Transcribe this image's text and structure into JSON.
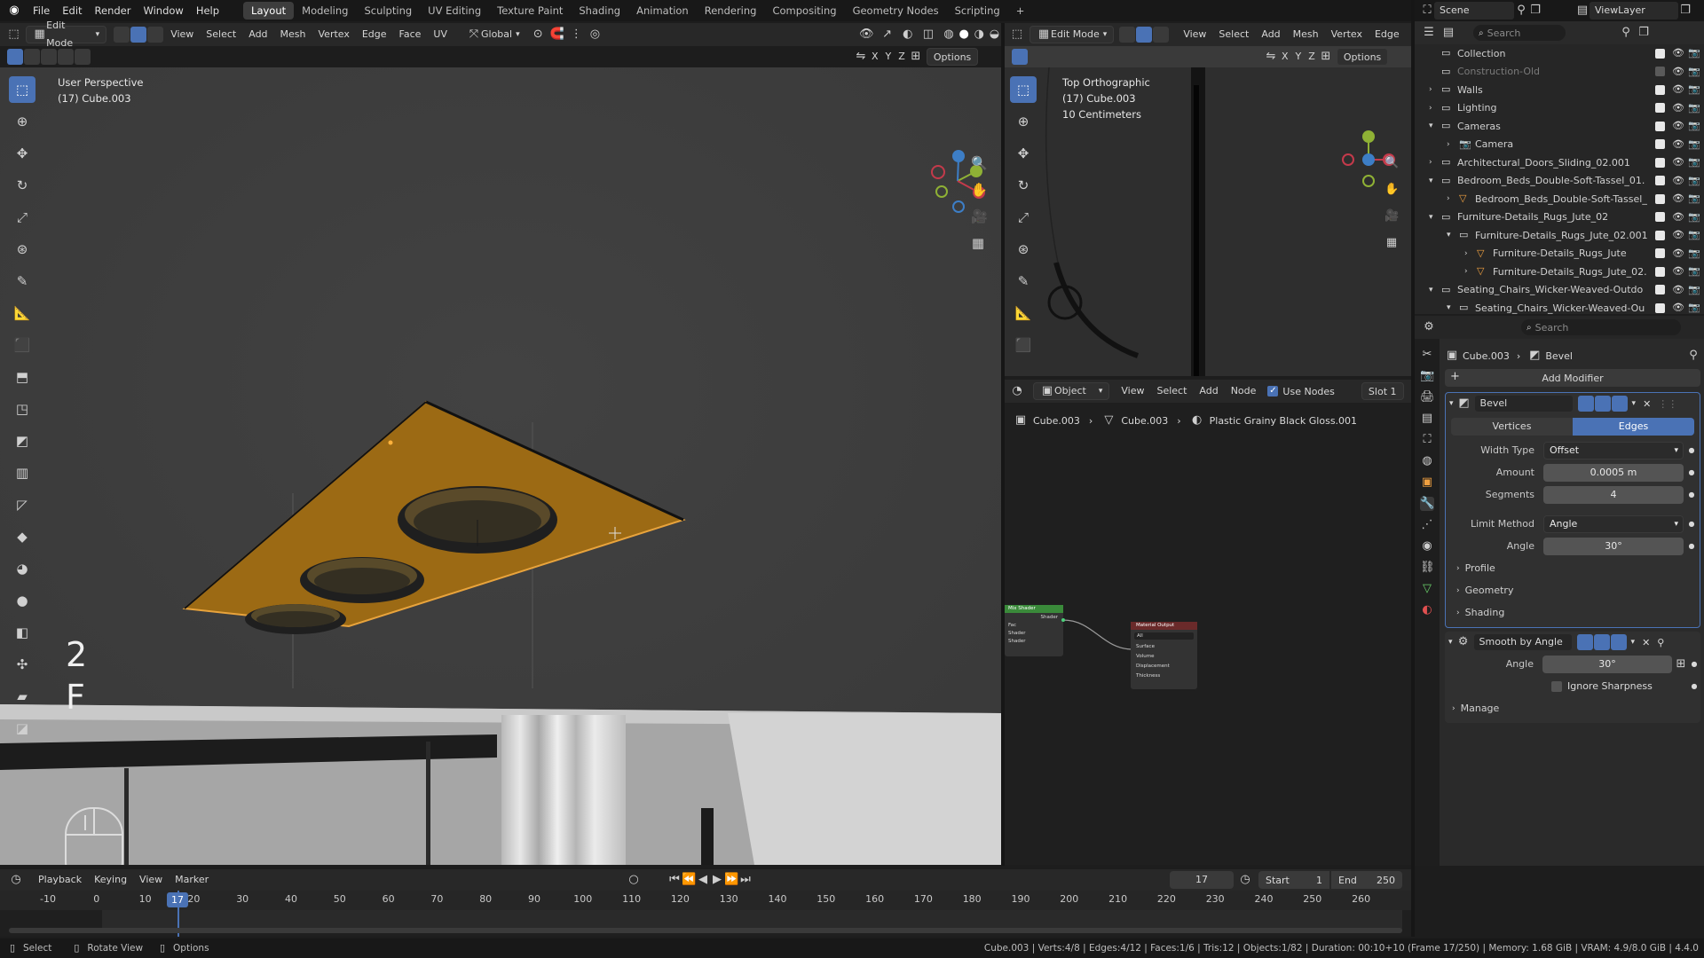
{
  "topbar": {
    "menus": [
      "File",
      "Edit",
      "Render",
      "Window",
      "Help"
    ],
    "workspaces": [
      "Layout",
      "Modeling",
      "Sculpting",
      "UV Editing",
      "Texture Paint",
      "Shading",
      "Animation",
      "Rendering",
      "Compositing",
      "Geometry Nodes",
      "Scripting"
    ],
    "active_workspace": "Layout",
    "scene": "Scene",
    "view_layer": "ViewLayer"
  },
  "viewport_left": {
    "mode": "Edit Mode",
    "menus": [
      "View",
      "Select",
      "Add",
      "Mesh",
      "Vertex",
      "Edge",
      "Face",
      "UV"
    ],
    "transform_orientation": "Global",
    "options": "Options",
    "axes": [
      "X",
      "Y",
      "Z"
    ],
    "overlay_title": "User Perspective",
    "overlay_object": "(17) Cube.003",
    "key_hint_1": "2",
    "key_hint_2": "F"
  },
  "viewport_right": {
    "mode": "Edit Mode",
    "menus": [
      "View",
      "Select",
      "Add",
      "Mesh",
      "Vertex",
      "Edge"
    ],
    "options": "Options",
    "axes": [
      "X",
      "Y",
      "Z"
    ],
    "overlay_title": "Top Orthographic",
    "overlay_object": "(17) Cube.003",
    "overlay_scale": "10 Centimeters"
  },
  "node_editor": {
    "type": "Object",
    "menus": [
      "View",
      "Select",
      "Add",
      "Node"
    ],
    "use_nodes_label": "Use Nodes",
    "slot": "Slot 1",
    "breadcrumb": [
      "Cube.003",
      "Cube.003",
      "Plastic Grainy Black Gloss.001"
    ],
    "node_mix": "Mix Shader",
    "node_mix_out": "Shader",
    "node_mix_inputs": [
      "Fac",
      "Shader",
      "Shader"
    ],
    "node_output": "Material Output",
    "node_output_target": "All",
    "node_output_inputs": [
      "Surface",
      "Volume",
      "Displacement",
      "Thickness"
    ]
  },
  "outliner": {
    "search_placeholder": "Search",
    "items": [
      {
        "label": "Collection",
        "depth": 0,
        "expand": "",
        "icon": "collection"
      },
      {
        "label": "Construction-Old",
        "depth": 0,
        "expand": "",
        "icon": "collection",
        "dim": true
      },
      {
        "label": "Walls",
        "depth": 0,
        "expand": ">",
        "icon": "collection"
      },
      {
        "label": "Lighting",
        "depth": 0,
        "expand": ">",
        "icon": "collection"
      },
      {
        "label": "Cameras",
        "depth": 0,
        "expand": "v",
        "icon": "collection"
      },
      {
        "label": "Camera",
        "depth": 1,
        "expand": ">",
        "icon": "camera"
      },
      {
        "label": "Architectural_Doors_Sliding_02.001",
        "depth": 0,
        "expand": ">",
        "icon": "collection"
      },
      {
        "label": "Bedroom_Beds_Double-Soft-Tassel_01.",
        "depth": 0,
        "expand": "v",
        "icon": "collection"
      },
      {
        "label": "Bedroom_Beds_Double-Soft-Tassel_",
        "depth": 1,
        "expand": ">",
        "icon": "mesh"
      },
      {
        "label": "Furniture-Details_Rugs_Jute_02",
        "depth": 0,
        "expand": "v",
        "icon": "collection"
      },
      {
        "label": "Furniture-Details_Rugs_Jute_02.001",
        "depth": 1,
        "expand": "v",
        "icon": "collection"
      },
      {
        "label": "Furniture-Details_Rugs_Jute",
        "depth": 2,
        "expand": ">",
        "icon": "mesh"
      },
      {
        "label": "Furniture-Details_Rugs_Jute_02.",
        "depth": 2,
        "expand": ">",
        "icon": "mesh"
      },
      {
        "label": "Seating_Chairs_Wicker-Weaved-Outdo",
        "depth": 0,
        "expand": "v",
        "icon": "collection"
      },
      {
        "label": "Seating_Chairs_Wicker-Weaved-Ou",
        "depth": 1,
        "expand": "v",
        "icon": "collection"
      }
    ]
  },
  "properties": {
    "search_placeholder": "Search",
    "breadcrumb_object": "Cube.003",
    "breadcrumb_modifier": "Bevel",
    "add_modifier": "Add Modifier",
    "bevel": {
      "name": "Bevel",
      "tab_vertices": "Vertices",
      "tab_edges": "Edges",
      "width_type_label": "Width Type",
      "width_type": "Offset",
      "amount_label": "Amount",
      "amount": "0.0005 m",
      "segments_label": "Segments",
      "segments": "4",
      "limit_method_label": "Limit Method",
      "limit_method": "Angle",
      "angle_label": "Angle",
      "angle": "30°",
      "profile": "Profile",
      "geometry": "Geometry",
      "shading": "Shading"
    },
    "smooth": {
      "name": "Smooth by Angle",
      "angle_label": "Angle",
      "angle": "30°",
      "ignore_sharpness": "Ignore Sharpness",
      "manage": "Manage"
    }
  },
  "timeline": {
    "menus": [
      "Playback",
      "Keying",
      "View",
      "Marker"
    ],
    "current_frame": "17",
    "start_label": "Start",
    "start": "1",
    "end_label": "End",
    "end": "250",
    "ticks": [
      "-10",
      "0",
      "10",
      "20",
      "30",
      "40",
      "50",
      "60",
      "70",
      "80",
      "90",
      "100",
      "110",
      "120",
      "130",
      "140",
      "150",
      "160",
      "170",
      "180",
      "190",
      "200",
      "210",
      "220",
      "230",
      "240",
      "250",
      "260"
    ],
    "playhead_label": "17"
  },
  "statusbar": {
    "select": "Select",
    "rotate_view": "Rotate View",
    "options": "Options",
    "stats": "Cube.003 | Verts:4/8 | Edges:4/12 | Faces:1/6 | Tris:12 | Objects:1/82 | Duration: 00:10+10 (Frame 17/250) | Memory: 1.68 GiB | VRAM: 4.9/8.0 GiB | 4.4.0"
  },
  "colors": {
    "accent": "#4a72b5",
    "selection_orange": "#e8a33c",
    "face_orange": "#9c6a14"
  }
}
